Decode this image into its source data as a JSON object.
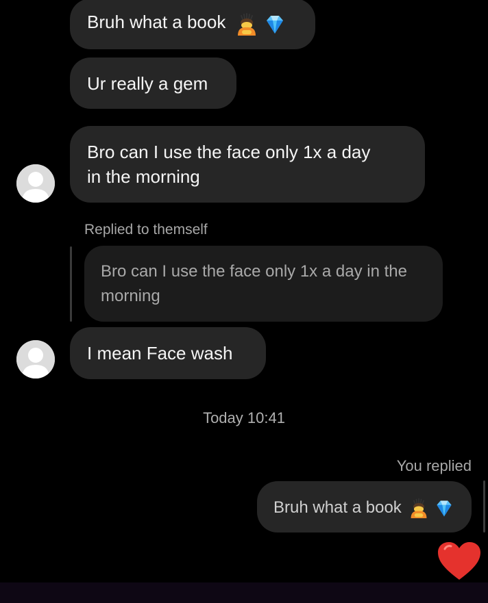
{
  "messages": [
    {
      "text": "Bruh what a book",
      "emoji": [
        "person-bowing-icon",
        "gem-icon"
      ]
    },
    {
      "text": "Ur really a gem"
    },
    {
      "line1": "Bro can I use the face only 1x a day",
      "line2": "in the morning"
    },
    {
      "text": "I mean Face wash"
    }
  ],
  "reply_context": {
    "label": "Replied to themself",
    "quoted_line1": "Bro can I use the face only 1x a day in the",
    "quoted_line2": "morning"
  },
  "timestamp": "Today 10:41",
  "own_reply": {
    "label": "You replied",
    "text": "Bruh what a book",
    "emoji": [
      "person-bowing-icon",
      "gem-icon"
    ]
  },
  "reaction": "red-heart-icon",
  "colors": {
    "background": "#000000",
    "bubble": "#262626",
    "quoted_bubble": "#1c1c1c",
    "meta_text": "#a8a8a8",
    "heart": "#e5322d"
  }
}
